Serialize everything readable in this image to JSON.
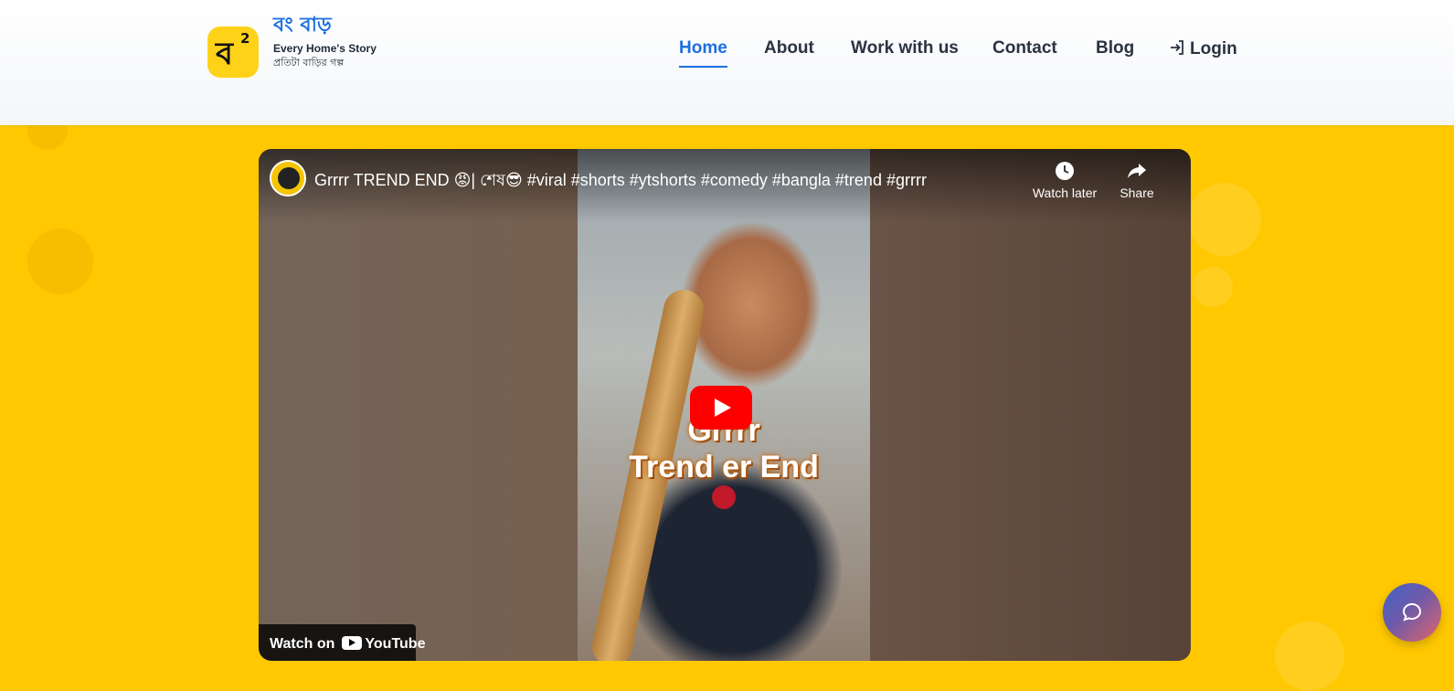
{
  "brand": {
    "logo_glyph": "ব",
    "logo_superscript": "2",
    "name": "বং বাড়",
    "tagline": "Every Home's Story",
    "subtagline": "প্রতিটা বাড়ির গল্প"
  },
  "nav": {
    "items": [
      {
        "label": "Home",
        "active": true
      },
      {
        "label": "About",
        "active": false
      },
      {
        "label": "Work with us",
        "active": false
      },
      {
        "label": "Contact",
        "active": false
      },
      {
        "label": "Blog",
        "active": false
      }
    ],
    "login_label": "Login"
  },
  "video": {
    "title": "Grrrr TREND END 😡| শেষ😎 #viral #shorts #ytshorts #comedy #bangla #trend #grrrr",
    "watch_later_label": "Watch later",
    "share_label": "Share",
    "caption_line1": "Grrrr",
    "caption_line2": "Trend er End",
    "watch_on_label": "Watch on",
    "youtube_label": "YouTube"
  },
  "colors": {
    "page_background": "#ffc800",
    "nav_active": "#1d6fe0",
    "youtube_red": "#ff0000"
  },
  "icons": {
    "login": "login-arrow-icon",
    "watch_later": "clock-icon",
    "share": "share-arrow-icon",
    "play": "play-icon",
    "chat": "chat-bubble-icon"
  }
}
